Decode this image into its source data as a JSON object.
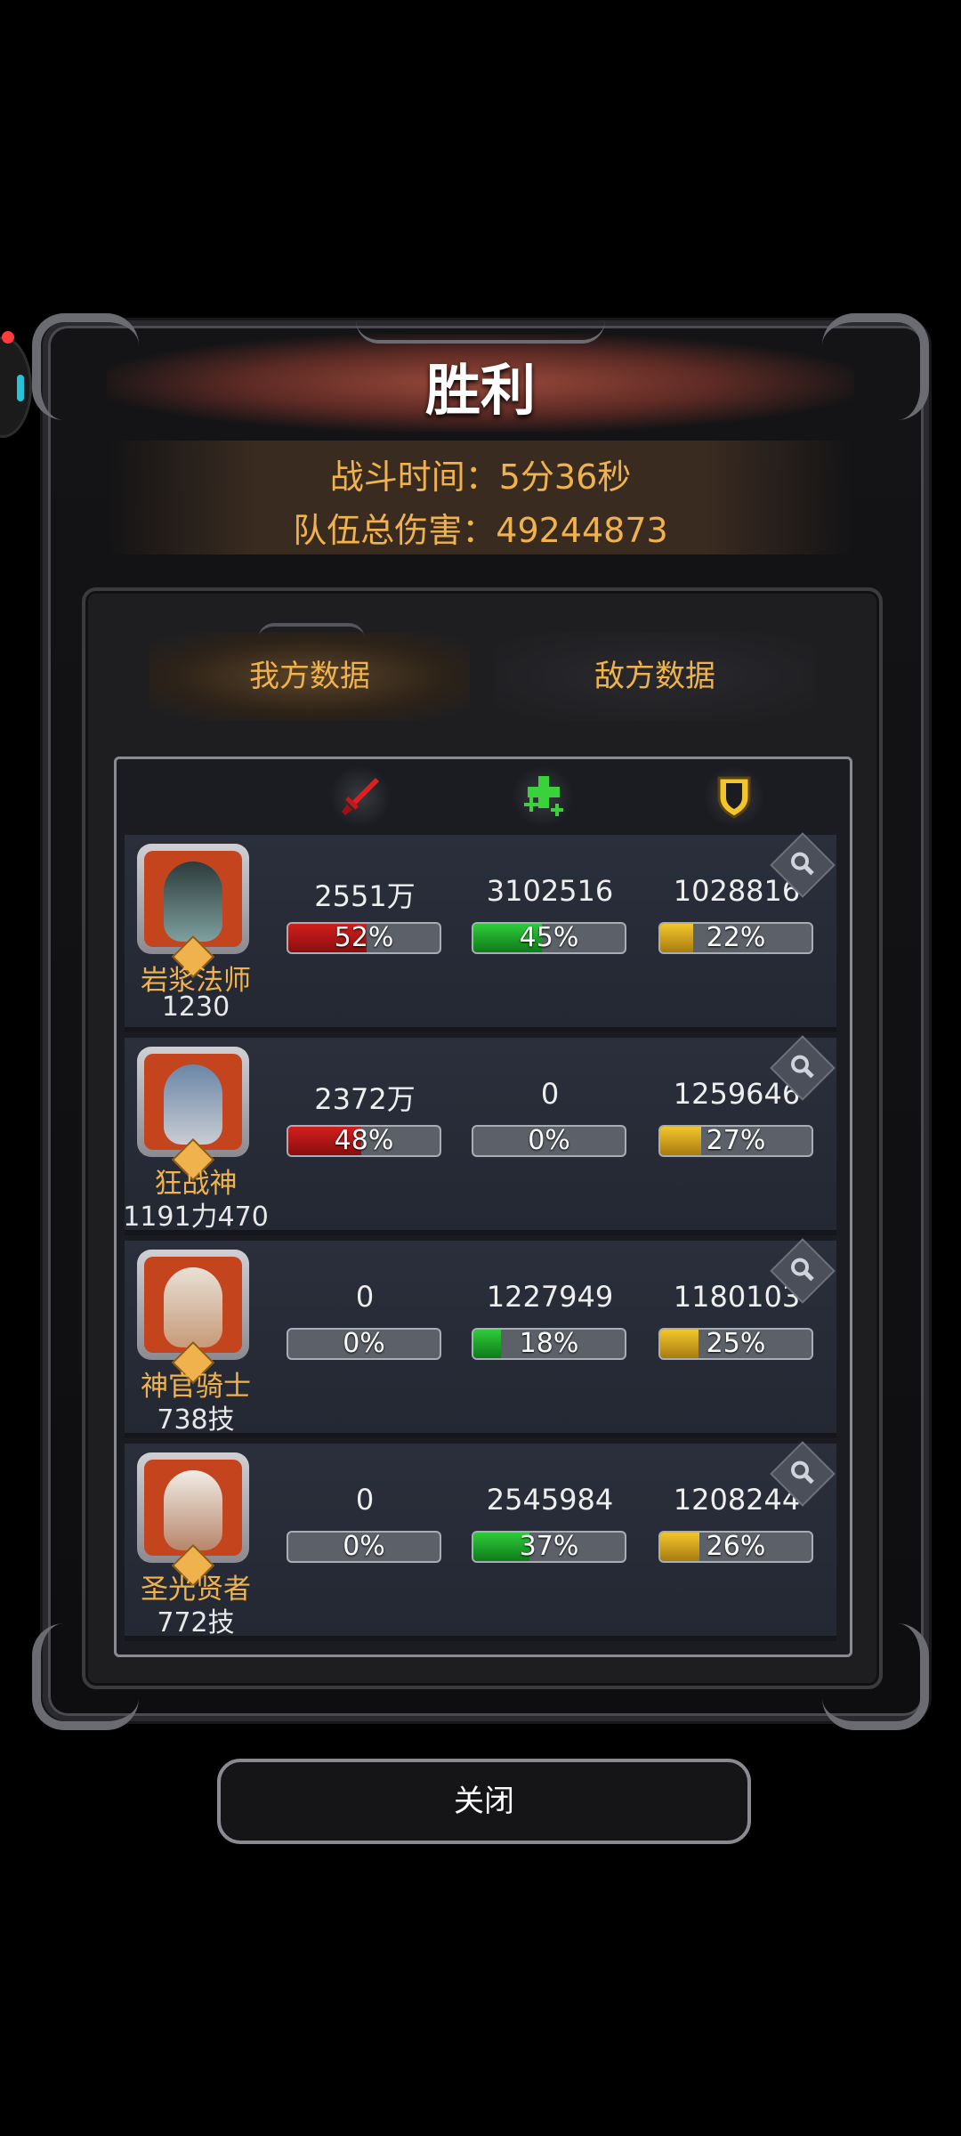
{
  "title": "胜利",
  "battle_time": "战斗时间：5分36秒",
  "team_damage": "队伍总伤害：49244873",
  "tabs": {
    "mine": "我方数据",
    "enemy": "敌方数据"
  },
  "header_icons": [
    "sword-icon",
    "heal-cross-icon",
    "shield-icon"
  ],
  "colors": {
    "gold_text": "#f0b24c",
    "damage_bar": "#d21e1e",
    "heal_bar": "#2ecc3a",
    "tank_bar": "#f2c62b"
  },
  "heroes": [
    {
      "name": "岩浆法师",
      "sub": "1230",
      "damage": "2551万",
      "damage_pct": "52%",
      "damage_frac": 0.52,
      "heal": "3102516",
      "heal_pct": "45%",
      "heal_frac": 0.45,
      "tank": "1028816",
      "tank_pct": "22%",
      "tank_frac": 0.22
    },
    {
      "name": "狂战神",
      "sub": "1191力470",
      "damage": "2372万",
      "damage_pct": "48%",
      "damage_frac": 0.48,
      "heal": "0",
      "heal_pct": "0%",
      "heal_frac": 0,
      "tank": "1259646",
      "tank_pct": "27%",
      "tank_frac": 0.27
    },
    {
      "name": "神官骑士",
      "sub": "738技",
      "damage": "0",
      "damage_pct": "0%",
      "damage_frac": 0,
      "heal": "1227949",
      "heal_pct": "18%",
      "heal_frac": 0.18,
      "tank": "1180103",
      "tank_pct": "25%",
      "tank_frac": 0.25
    },
    {
      "name": "圣光贤者",
      "sub": "772技",
      "damage": "0",
      "damage_pct": "0%",
      "damage_frac": 0,
      "heal": "2545984",
      "heal_pct": "37%",
      "heal_frac": 0.37,
      "tank": "1208244",
      "tank_pct": "26%",
      "tank_frac": 0.26
    }
  ],
  "close_label": "关闭"
}
